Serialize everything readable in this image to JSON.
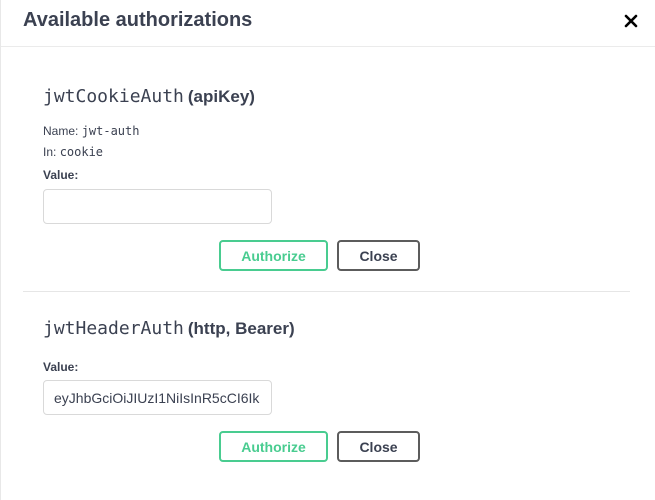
{
  "modal": {
    "title": "Available authorizations",
    "close_icon": "close-x-icon"
  },
  "schemes": [
    {
      "name": "jwtCookieAuth",
      "type": "(apiKey)",
      "meta": {
        "name_label": "Name:",
        "name_value": "jwt-auth",
        "in_label": "In:",
        "in_value": "cookie"
      },
      "value_label": "Value:",
      "value": "",
      "authorize_label": "Authorize",
      "close_label": "Close"
    },
    {
      "name": "jwtHeaderAuth",
      "type": "(http, Bearer)",
      "value_label": "Value:",
      "value": "eyJhbGciOiJIUzI1NiIsInR5cCI6Ik",
      "authorize_label": "Authorize",
      "close_label": "Close"
    }
  ],
  "colors": {
    "authorize": "#49cc90",
    "close_border": "#5c5c5c",
    "text": "#3b4151"
  }
}
